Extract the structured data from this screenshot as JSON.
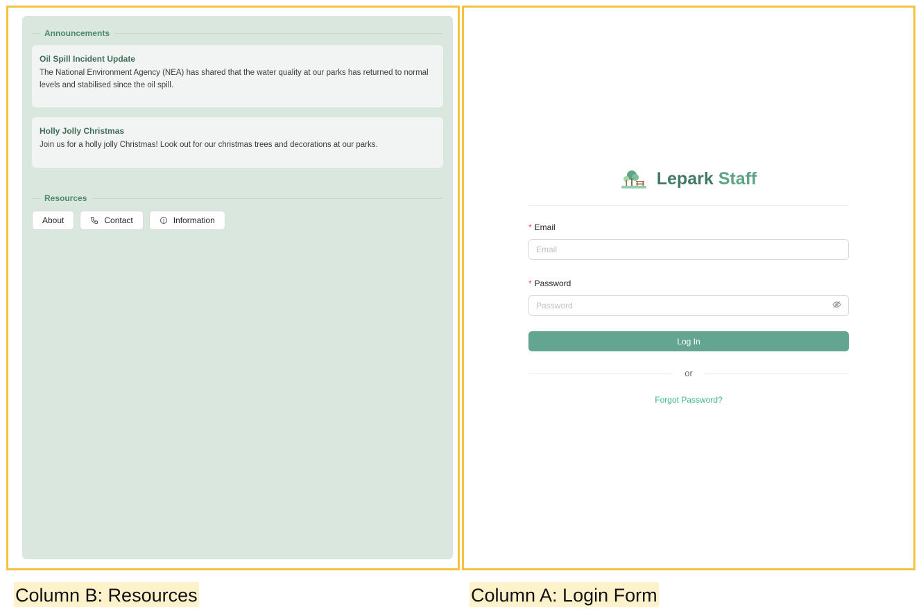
{
  "column_b": {
    "announcements_title": "Announcements",
    "announcements": [
      {
        "title": "Oil Spill Incident Update",
        "text": "The National Environment Agency (NEA) has shared that the water quality at our parks has returned to normal levels and stabilised since the oil spill."
      },
      {
        "title": "Holly Jolly Christmas",
        "text": "Join us for a holly jolly Christmas! Look out for our christmas trees and decorations at our parks."
      }
    ],
    "resources_title": "Resources",
    "resource_buttons": [
      {
        "label": "About",
        "icon": ""
      },
      {
        "label": "Contact",
        "icon": "phone-icon"
      },
      {
        "label": "Information",
        "icon": "info-circle-icon"
      }
    ]
  },
  "column_a": {
    "brand_first": "Lepark",
    "brand_second": "Staff",
    "email_label": "Email",
    "email_placeholder": "Email",
    "password_label": "Password",
    "password_placeholder": "Password",
    "login_label": "Log In",
    "or_text": "or",
    "forgot_label": "Forgot Password?"
  },
  "captions": {
    "b": "Column B: Resources",
    "a": "Column A: Login Form"
  },
  "colors": {
    "frame": "#f5c242",
    "panel_bg": "#dae7de",
    "brand": "#437a65",
    "button": "#64a591",
    "link": "#3cba7e",
    "caption_bg": "#fef2cc"
  }
}
